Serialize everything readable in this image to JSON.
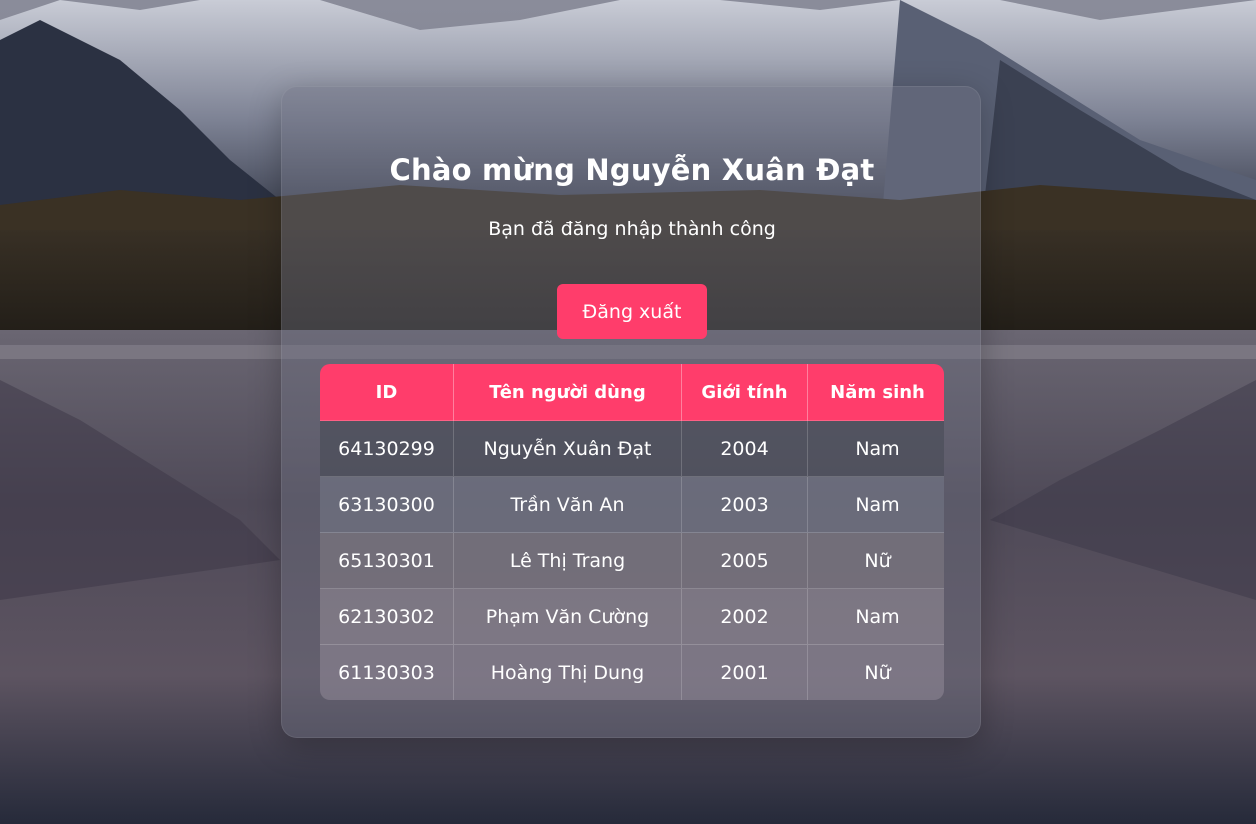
{
  "page": {
    "title": "Chào mừng Nguyễn Xuân Đạt",
    "subtitle": "Bạn đã đăng nhập thành công",
    "logout_label": "Đăng xuất"
  },
  "table": {
    "headers": [
      "ID",
      "Tên người dùng",
      "Giới tính",
      "Năm sinh"
    ],
    "rows": [
      [
        "64130299",
        "Nguyễn Xuân Đạt",
        "2004",
        "Nam"
      ],
      [
        "63130300",
        "Trần Văn An",
        "2003",
        "Nam"
      ],
      [
        "65130301",
        "Lê Thị Trang",
        "2005",
        "Nữ"
      ],
      [
        "62130302",
        "Phạm Văn Cường",
        "2002",
        "Nam"
      ],
      [
        "61130303",
        "Hoàng Thị Dung",
        "2001",
        "Nữ"
      ]
    ]
  },
  "colors": {
    "accent": "#ff3d6b"
  }
}
